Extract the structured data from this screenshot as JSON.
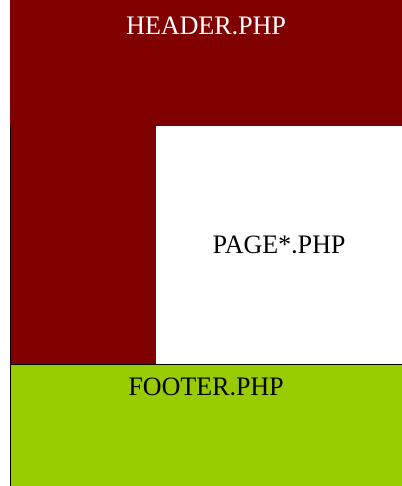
{
  "blocks": {
    "header": {
      "label": "HEADER.PHP",
      "color": "#800000"
    },
    "sidebar": {
      "color": "#800000"
    },
    "page": {
      "label": "PAGE*.PHP",
      "color": "#ffffff"
    },
    "footer": {
      "label": "FOOTER.PHP",
      "color": "#99cc00"
    }
  }
}
